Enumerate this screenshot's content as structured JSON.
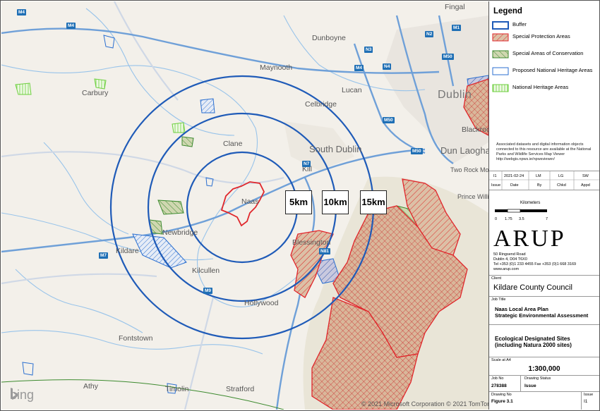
{
  "map": {
    "places": [
      {
        "name": "Fingal"
      },
      {
        "name": "Dunboyne"
      },
      {
        "name": "Carbury"
      },
      {
        "name": "Maynooth"
      },
      {
        "name": "Lucan"
      },
      {
        "name": "Dublin"
      },
      {
        "name": "Celbridge"
      },
      {
        "name": "Clane"
      },
      {
        "name": "South Dublin"
      },
      {
        "name": "Dun Laoghaire"
      },
      {
        "name": "Kildare"
      },
      {
        "name": "Naas"
      },
      {
        "name": "Kill"
      },
      {
        "name": "Two Rock Mountain"
      },
      {
        "name": "Newbridge"
      },
      {
        "name": "Kilcullen"
      },
      {
        "name": "Blessington"
      },
      {
        "name": "Hollywood"
      },
      {
        "name": "Fontstown"
      },
      {
        "name": "Timolin"
      },
      {
        "name": "Athy"
      },
      {
        "name": "Stratford"
      },
      {
        "name": "Blackrock"
      },
      {
        "name": "Prince William's Seat"
      }
    ],
    "road_badges": [
      "M4",
      "M4",
      "M1",
      "N2",
      "M50",
      "N3",
      "M4",
      "N4",
      "M50",
      "M50",
      "N7",
      "N81",
      "M7",
      "M9"
    ],
    "buffers": [
      "5km",
      "10km",
      "15km"
    ],
    "provider": "bing",
    "copyright": "© 2021 Microsoft Corporation © 2021 TomTom"
  },
  "panel": {
    "legend": {
      "title": "Legend",
      "items": [
        {
          "label": "Buffer",
          "swatch": "buffer"
        },
        {
          "label": "Special Protection Areas",
          "swatch": "spa"
        },
        {
          "label": "Special Areas of Conservation",
          "swatch": "sac"
        },
        {
          "label": "Proposed National Heritage Areas",
          "swatch": "pnha"
        },
        {
          "label": "National Heritage Areas",
          "swatch": "nha"
        }
      ],
      "note": "Associated datasets and digital information objects connected to this resource are available at the National Parks and Wildlife Services Map Viewer http://webgis.npws.ie/npwsviewer/"
    },
    "revision": {
      "values": [
        "I1",
        "2021-02-24",
        "LM",
        "LG",
        "SW"
      ],
      "headers": [
        "Issue",
        "Date",
        "By",
        "Chkd",
        "Appd"
      ]
    },
    "scalebar": {
      "title": "Kilometers",
      "ticks": [
        "0",
        "1.75",
        "3.5",
        "7"
      ]
    },
    "company": {
      "logo": "ARUP",
      "address": [
        "50 Ringsend Road",
        "Dublin 4, D04 T6X0",
        "Tel +353 (0)1 233 4455 Fax +353 (0)1 668 3169",
        "www.arup.com"
      ]
    },
    "client": {
      "label": "Client",
      "value": "Kildare County Council"
    },
    "job_title": {
      "label": "Job Title",
      "line1": "Naas Local Area Plan",
      "line2": "Strategic Environmental Assessment"
    },
    "drawing_title": {
      "line1": "Ecological Designated Sites",
      "line2": "(including Natura 2000 sites)"
    },
    "scale": {
      "label": "Scale at A4",
      "value": "1:300,000"
    },
    "job_no": {
      "label": "Job No",
      "value": "278388"
    },
    "drawing_status": {
      "label": "Drawing Status",
      "value": "Issue"
    },
    "drawing_no": {
      "label": "Drawing No",
      "value": "Figure 3.1"
    },
    "issue": {
      "label": "Issue",
      "value": "I1"
    }
  },
  "colors": {
    "buffer": "#1f5bb8",
    "spa": "#e0262b",
    "sac": "#3c8a2e",
    "pnha": "#2b6fd0",
    "nha": "#6ccf3d",
    "hatch_fill": "#d8b79a"
  }
}
